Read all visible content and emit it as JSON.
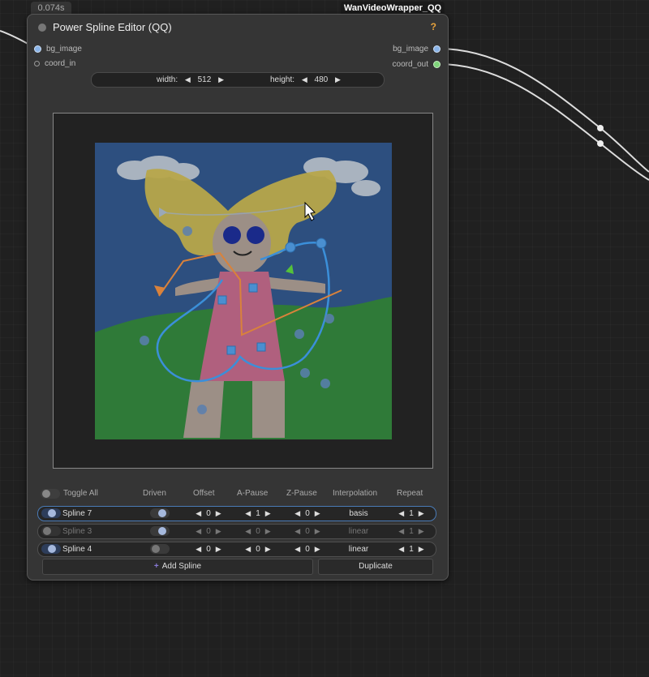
{
  "node": {
    "timing": "0.074s",
    "wrapper_tag": "WanVideoWrapper_QQ",
    "title": "Power Spline Editor (QQ)",
    "help": "?",
    "inputs": [
      {
        "label": "bg_image"
      },
      {
        "label": "coord_in"
      }
    ],
    "outputs": [
      {
        "label": "bg_image"
      },
      {
        "label": "coord_out"
      }
    ],
    "width_label": "width:",
    "width_value": "512",
    "height_label": "height:",
    "height_value": "480"
  },
  "spline_table": {
    "toggle_all": "Toggle All",
    "headers": {
      "driven": "Driven",
      "offset": "Offset",
      "a_pause": "A-Pause",
      "z_pause": "Z-Pause",
      "interpolation": "Interpolation",
      "repeat": "Repeat"
    },
    "rows": [
      {
        "name": "Spline 7",
        "enabled": true,
        "driven": true,
        "offset": "0",
        "a_pause": "1",
        "z_pause": "0",
        "interpolation": "basis",
        "repeat": "1"
      },
      {
        "name": "Spline 3",
        "enabled": false,
        "driven": true,
        "offset": "0",
        "a_pause": "0",
        "z_pause": "0",
        "interpolation": "linear",
        "repeat": "1"
      },
      {
        "name": "Spline 4",
        "enabled": true,
        "driven": false,
        "offset": "0",
        "a_pause": "0",
        "z_pause": "0",
        "interpolation": "linear",
        "repeat": "1"
      }
    ],
    "add_label": "Add Spline",
    "duplicate_label": "Duplicate"
  },
  "colors": {
    "spline_blue": "#3b8fd9",
    "spline_orange": "#d9823b",
    "spline_grey": "#9aa8b8",
    "accent_green": "#55c23a",
    "help_orange": "#e8a33d"
  },
  "icons": {
    "arrow_left": "◀",
    "arrow_right": "▶",
    "add": "+"
  }
}
